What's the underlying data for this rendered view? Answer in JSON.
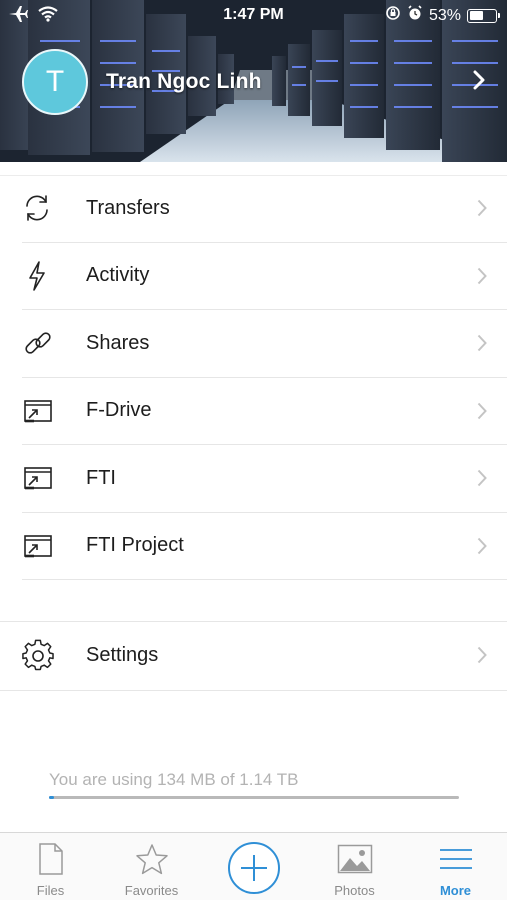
{
  "status_bar": {
    "time": "1:47 PM",
    "battery_percent": "53%",
    "battery_level": 0.53,
    "icons": [
      "airplane-icon",
      "wifi-icon",
      "rotation-lock-icon",
      "alarm-icon",
      "battery-icon"
    ]
  },
  "profile": {
    "avatar_initial": "T",
    "name": "Tran Ngoc Linh"
  },
  "menu": {
    "items": [
      {
        "label": "Transfers",
        "icon": "sync-icon"
      },
      {
        "label": "Activity",
        "icon": "lightning-icon"
      },
      {
        "label": "Shares",
        "icon": "link-icon"
      },
      {
        "label": "F-Drive",
        "icon": "external-drive-icon"
      },
      {
        "label": "FTI",
        "icon": "external-drive-icon"
      },
      {
        "label": "FTI Project",
        "icon": "external-drive-icon"
      }
    ],
    "settings": {
      "label": "Settings",
      "icon": "gear-icon"
    }
  },
  "storage": {
    "usage_text": "You are using 134 MB of 1.14 TB",
    "used_fraction": 0.012
  },
  "tabbar": {
    "tabs": [
      {
        "label": "Files",
        "icon": "file-icon",
        "active": false
      },
      {
        "label": "Favorites",
        "icon": "star-icon",
        "active": false
      },
      {
        "label": "Photos",
        "icon": "photo-icon",
        "active": false
      },
      {
        "label": "More",
        "icon": "menu-icon",
        "active": true
      }
    ],
    "add_icon": "plus-circle-icon"
  },
  "colors": {
    "accent": "#2f8fd6",
    "avatar": "#5ec8dc",
    "divider": "#e6e6e6",
    "muted_text": "#b3b3b3"
  }
}
